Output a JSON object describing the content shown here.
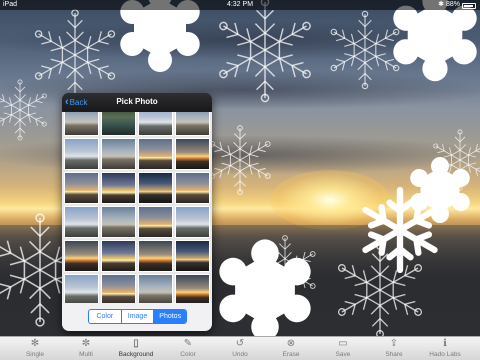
{
  "status_bar": {
    "device": "iPad",
    "time": "4:32 PM",
    "battery": "88%",
    "battery_level": 0.88
  },
  "popover": {
    "back_label": "Back",
    "title": "Pick Photo",
    "segments": [
      {
        "label": "Color",
        "active": false
      },
      {
        "label": "Image",
        "active": false
      },
      {
        "label": "Photos",
        "active": true
      }
    ]
  },
  "toolbar": {
    "items": [
      {
        "label": "Single",
        "icon": "snowflake-icon"
      },
      {
        "label": "Multi",
        "icon": "multi-snowflake-icon"
      },
      {
        "label": "Background",
        "icon": "document-icon",
        "active": true
      },
      {
        "label": "Color",
        "icon": "brush-icon"
      },
      {
        "label": "Undo",
        "icon": "undo-icon"
      },
      {
        "label": "Erase",
        "icon": "erase-icon"
      },
      {
        "label": "Save",
        "icon": "save-icon"
      },
      {
        "label": "Share",
        "icon": "share-icon"
      },
      {
        "label": "Hado Labs",
        "icon": "info-icon"
      }
    ]
  }
}
